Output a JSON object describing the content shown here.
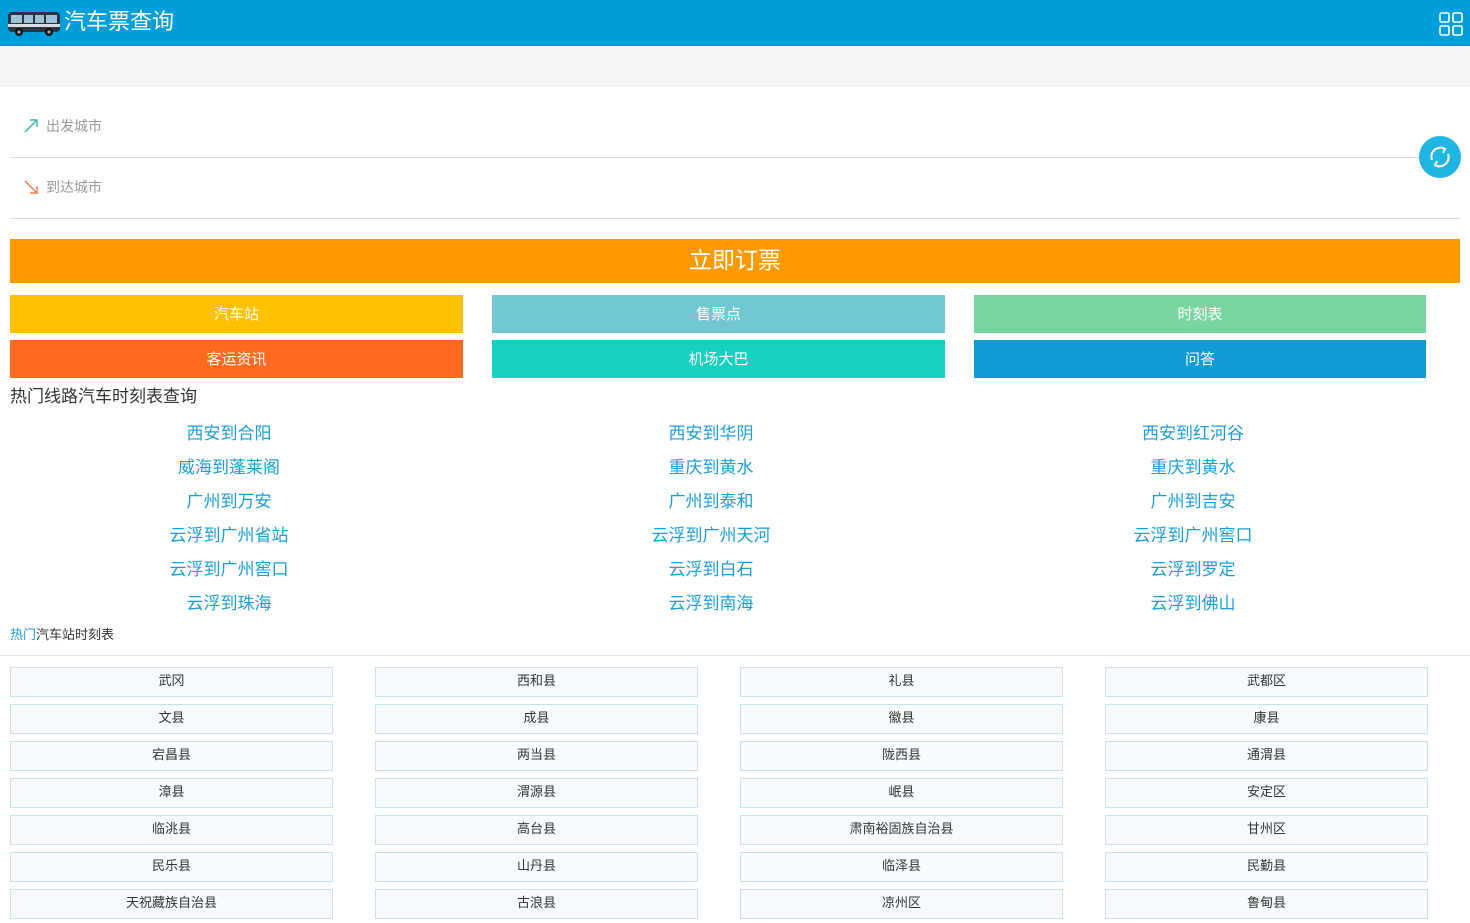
{
  "header": {
    "title": "汽车票查询",
    "logo_icon": "bus-icon",
    "menu_icon": "grid-icon",
    "background": "#009fdb"
  },
  "search": {
    "from_placeholder": "出发城市",
    "to_placeholder": "到达城市",
    "from_icon": "arrow-up-right-icon",
    "to_icon": "arrow-down-right-icon",
    "swap_icon": "swap-refresh-icon"
  },
  "book_button": {
    "label": "立即订票",
    "color": "#ff9900"
  },
  "nav": [
    {
      "label": "汽车站",
      "color": "#ffc000"
    },
    {
      "label": "售票点",
      "color": "#71c7d2"
    },
    {
      "label": "时刻表",
      "color": "#77d6a0"
    },
    {
      "label": "客运资讯",
      "color": "#ff6a22"
    },
    {
      "label": "机场大巴",
      "color": "#14d1c0"
    },
    {
      "label": "问答",
      "color": "#0f9ad8"
    }
  ],
  "hot_routes": {
    "title": "热门线路汽车时刻表查询",
    "items": [
      "西安到合阳",
      "西安到华阴",
      "西安到红河谷",
      "威海到蓬莱阁",
      "重庆到黄水",
      "重庆到黄水",
      "广州到万安",
      "广州到泰和",
      "广州到吉安",
      "云浮到广州省站",
      "云浮到广州天河",
      "云浮到广州窖口",
      "云浮到广州窖口",
      "云浮到白石",
      "云浮到罗定",
      "云浮到珠海",
      "云浮到南海",
      "云浮到佛山"
    ]
  },
  "hot_stations": {
    "title_hot": "热门",
    "title_rest": "汽车站时刻表",
    "items": [
      "武冈",
      "西和县",
      "礼县",
      "武都区",
      "文县",
      "成县",
      "徽县",
      "康县",
      "宕昌县",
      "两当县",
      "陇西县",
      "通渭县",
      "漳县",
      "渭源县",
      "岷县",
      "安定区",
      "临洮县",
      "高台县",
      "肃南裕固族自治县",
      "甘州区",
      "民乐县",
      "山丹县",
      "临泽县",
      "民勤县",
      "天祝藏族自治县",
      "古浪县",
      "凉州区",
      "鲁甸县"
    ]
  }
}
